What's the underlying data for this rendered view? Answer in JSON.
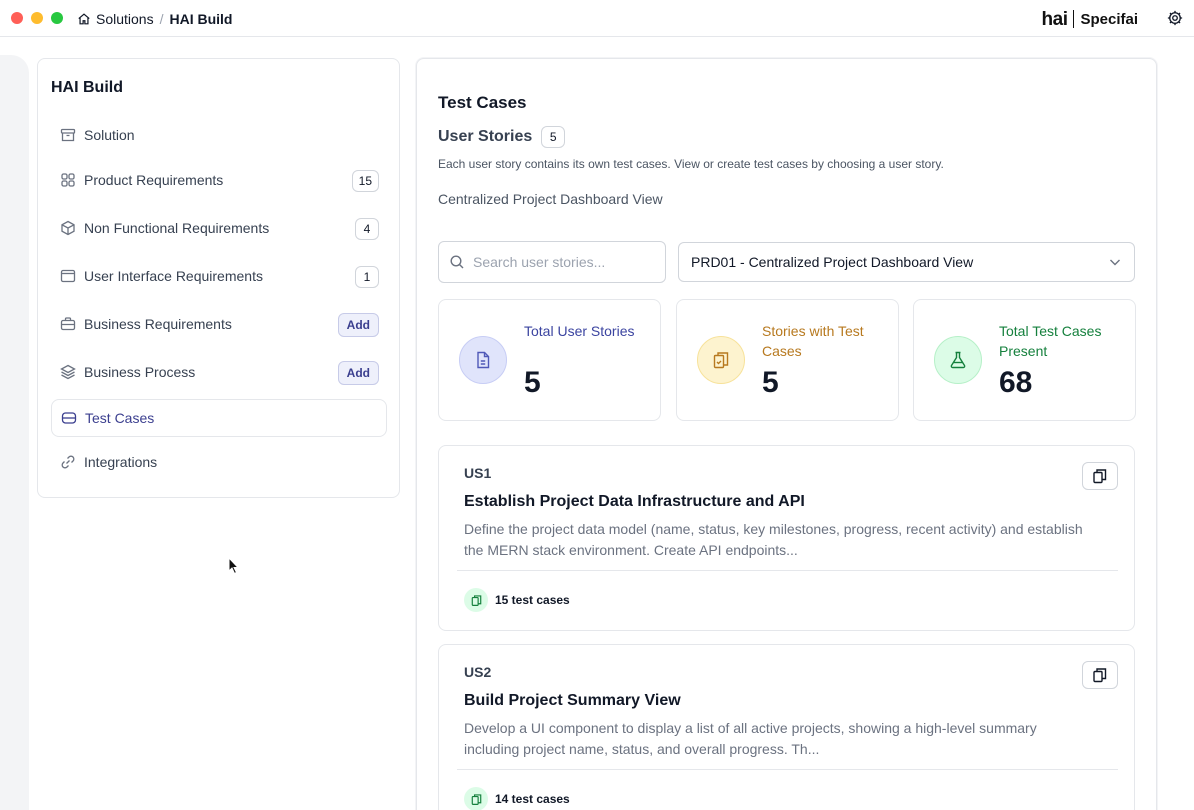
{
  "titlebar": {
    "breadcrumb_root": "Solutions",
    "breadcrumb_sep": "/",
    "breadcrumb_current": "HAI Build",
    "brand_logo": "hai",
    "brand_name": "Specifai",
    "settings_icon": "gear-icon"
  },
  "sidebar": {
    "title": "HAI Build",
    "items": [
      {
        "label": "Solution",
        "icon": "archive-icon"
      },
      {
        "label": "Product Requirements",
        "icon": "grid-icon",
        "badge": "15"
      },
      {
        "label": "Non Functional Requirements",
        "icon": "cube-icon",
        "badge": "4"
      },
      {
        "label": "User Interface Requirements",
        "icon": "window-icon",
        "badge": "1"
      },
      {
        "label": "Business Requirements",
        "icon": "briefcase-icon",
        "action": "Add"
      },
      {
        "label": "Business Process",
        "icon": "layers-icon",
        "action": "Add"
      },
      {
        "label": "Test Cases",
        "icon": "flask-stack-icon",
        "active": true
      },
      {
        "label": "Integrations",
        "icon": "link-icon"
      }
    ]
  },
  "main": {
    "title": "Test Cases",
    "user_stories_label": "User Stories",
    "user_stories_count": "5",
    "description": "Each user story contains its own test cases. View or create test cases by choosing a user story.",
    "selected_story_title": "Centralized Project Dashboard View",
    "search": {
      "placeholder": "Search user stories...",
      "value": ""
    },
    "requirement_select": {
      "value": "PRD01 - Centralized Project Dashboard View"
    },
    "stats": [
      {
        "label": "Total User Stories",
        "value": "5",
        "color": "#3b44a0"
      },
      {
        "label": "Stories with Test Cases",
        "value": "5",
        "color": "#b7791f"
      },
      {
        "label": "Total Test Cases Present",
        "value": "68",
        "color": "#15803d"
      }
    ],
    "stories": [
      {
        "id": "US1",
        "title": "Establish Project Data Infrastructure and API",
        "description": "Define the project data model (name, status, key milestones, progress, recent activity) and establish the MERN stack environment. Create API endpoints...",
        "test_cases": "15 test cases"
      },
      {
        "id": "US2",
        "title": "Build Project Summary View",
        "description": "Develop a UI component to display a list of all active projects, showing a high-level summary including project name, status, and overall progress. Th...",
        "test_cases": "14 test cases"
      }
    ]
  }
}
